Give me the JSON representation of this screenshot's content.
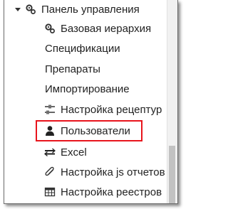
{
  "tree": {
    "parent": {
      "label": "Панель управления",
      "icon": "caret-down-icon",
      "secondary_icon": "gears-icon"
    },
    "items": [
      {
        "label": "Базовая иерархия",
        "icon": "gears-icon"
      },
      {
        "label": "Спецификации",
        "icon": ""
      },
      {
        "label": "Препараты",
        "icon": ""
      },
      {
        "label": "Импортирование",
        "icon": ""
      },
      {
        "label": "Настройка рецептур",
        "icon": "sliders-icon"
      },
      {
        "label": "Пользователи",
        "icon": "user-icon",
        "highlighted": true
      },
      {
        "label": "Excel",
        "icon": "exchange-icon"
      },
      {
        "label": "Настройка js отчетов",
        "icon": "paperclip-icon"
      },
      {
        "label": "Настройка реестров",
        "icon": "table-icon"
      }
    ]
  },
  "highlight_color": "#e8141c"
}
